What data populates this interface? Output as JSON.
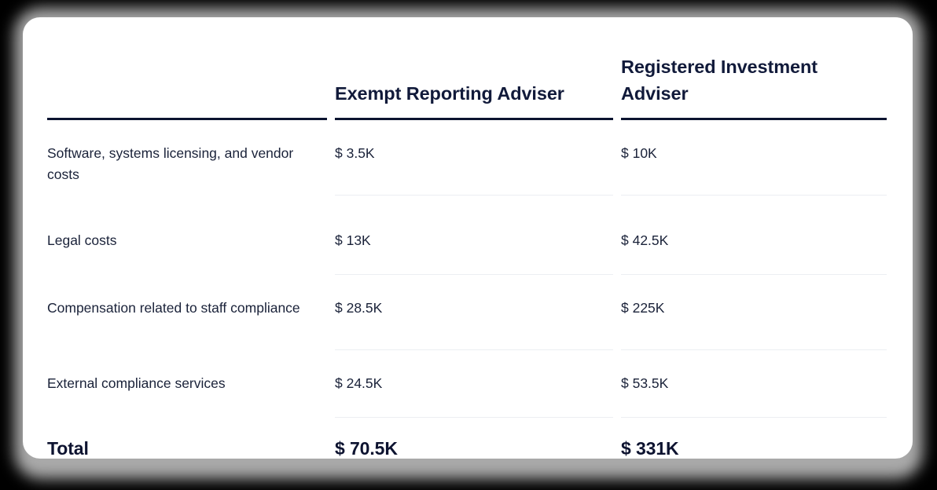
{
  "card": {
    "background": "#ffffff",
    "accent_text": "#111a3a",
    "rule_color": "#0c1430",
    "separator_color": "#eceef2"
  },
  "table": {
    "columns": [
      {
        "key": "label",
        "header": ""
      },
      {
        "key": "era",
        "header": "Exempt Reporting Adviser"
      },
      {
        "key": "ria",
        "header": "Registered Investment Adviser"
      }
    ],
    "rows": [
      {
        "label": "Software, systems licensing, and vendor costs",
        "era": "$ 3.5K",
        "ria": "$ 10K"
      },
      {
        "label": "Legal costs",
        "era": "$ 13K",
        "ria": "$ 42.5K"
      },
      {
        "label": "Compensation related to staff compliance",
        "era": "$ 28.5K",
        "ria": "$ 225K"
      },
      {
        "label": "External compliance services",
        "era": "$ 24.5K",
        "ria": "$ 53.5K"
      }
    ],
    "total": {
      "label": "Total",
      "era": "$ 70.5K",
      "ria": "$ 331K"
    }
  }
}
